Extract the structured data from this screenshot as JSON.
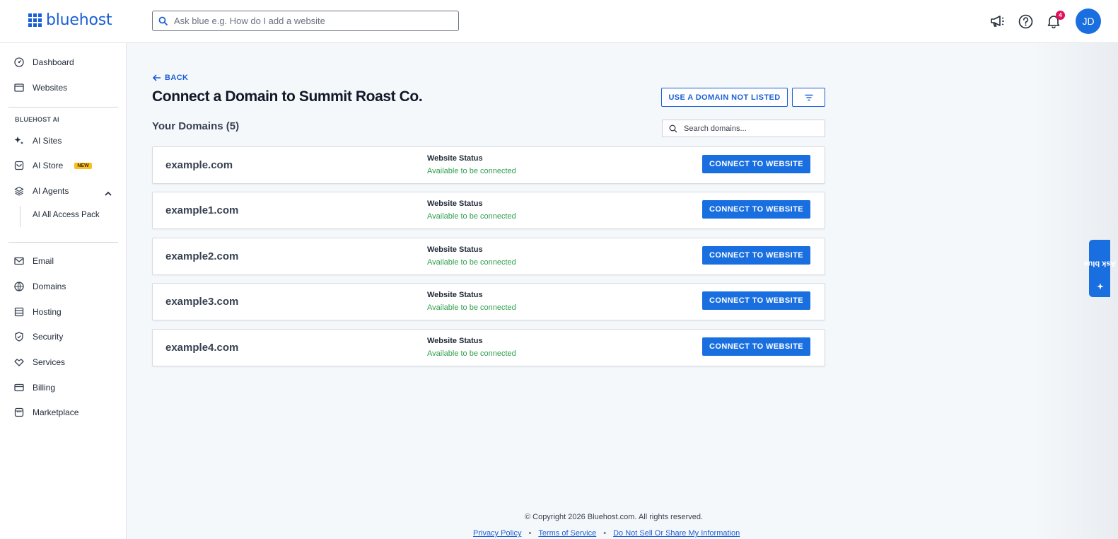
{
  "header": {
    "brand": "bluehost",
    "search_placeholder": "Ask blue e.g. How do I add a website",
    "notification_count": "4",
    "avatar_initials": "JD"
  },
  "sidebar": {
    "top_items": [
      {
        "label": "Dashboard",
        "icon": "dashboard-icon"
      },
      {
        "label": "Websites",
        "icon": "websites-icon"
      }
    ],
    "section_label": "BLUEHOST AI",
    "ai_items": [
      {
        "label": "AI Sites",
        "icon": "sparkle-icon"
      },
      {
        "label": "AI Store",
        "icon": "store-icon",
        "badge": "NEW"
      },
      {
        "label": "AI Agents",
        "icon": "layers-icon"
      }
    ],
    "ai_sub_item": "AI All Access Pack",
    "bottom_items": [
      {
        "label": "Email",
        "icon": "mail-icon"
      },
      {
        "label": "Domains",
        "icon": "globe-icon"
      },
      {
        "label": "Hosting",
        "icon": "server-icon"
      },
      {
        "label": "Security",
        "icon": "shield-icon"
      },
      {
        "label": "Services",
        "icon": "handshake-icon"
      },
      {
        "label": "Billing",
        "icon": "credit-card-icon"
      },
      {
        "label": "Marketplace",
        "icon": "storefront-icon"
      }
    ]
  },
  "main": {
    "back_label": "BACK",
    "title": "Connect a Domain to Summit Roast Co.",
    "use_domain_label": "USE A DOMAIN NOT LISTED",
    "domains_heading": "Your Domains (5)",
    "search_placeholder": "Search domains...",
    "domains": [
      {
        "name": "example.com",
        "status_label": "Website Status",
        "status": "Available to be connected",
        "action": "CONNECT TO WEBSITE"
      },
      {
        "name": "example1.com",
        "status_label": "Website Status",
        "status": "Available to be connected",
        "action": "CONNECT TO WEBSITE"
      },
      {
        "name": "example2.com",
        "status_label": "Website Status",
        "status": "Available to be connected",
        "action": "CONNECT TO WEBSITE"
      },
      {
        "name": "example3.com",
        "status_label": "Website Status",
        "status": "Available to be connected",
        "action": "CONNECT TO WEBSITE"
      },
      {
        "name": "example4.com",
        "status_label": "Website Status",
        "status": "Available to be connected",
        "action": "CONNECT TO WEBSITE"
      }
    ]
  },
  "footer": {
    "copyright": "© Copyright 2026 Bluehost.com. All rights reserved.",
    "links": [
      "Privacy Policy",
      "Terms of Service",
      "Do Not Sell Or Share My Information"
    ]
  },
  "ask_blue_label": "Ask blue",
  "colors": {
    "brand": "#1a5fd6",
    "button": "#1a6fe0",
    "status_green": "#2e9e4d",
    "badge_red": "#e1115c",
    "new_badge": "#fbbf24"
  }
}
